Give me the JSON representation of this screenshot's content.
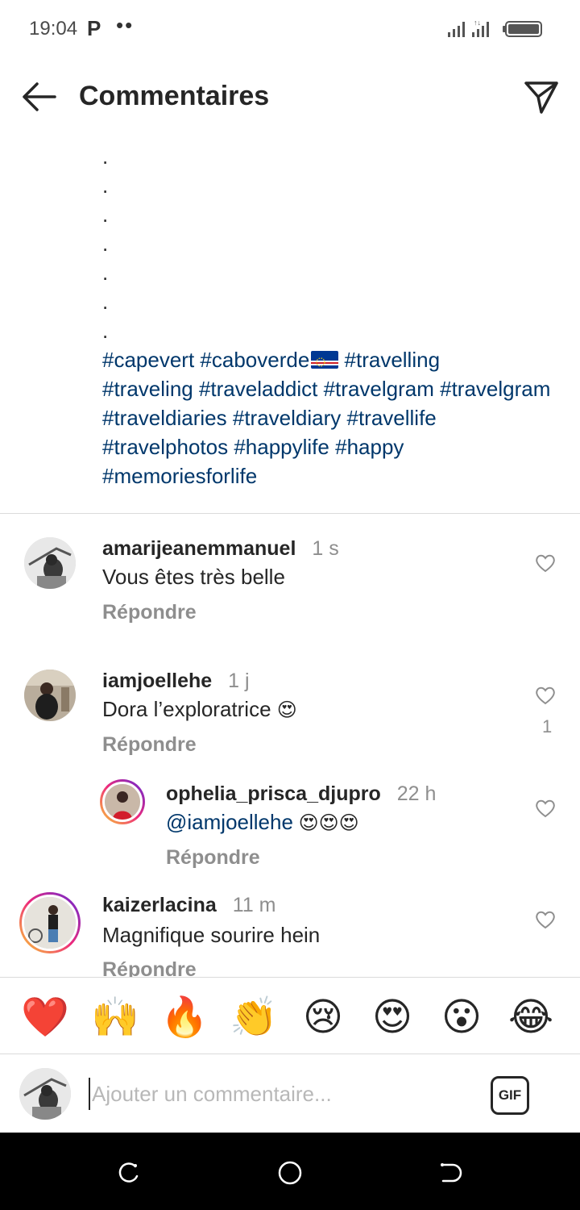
{
  "status_bar": {
    "time": "19:04",
    "app_indicator": "P",
    "dots": "••",
    "icons": [
      "signal-icon",
      "signal-icon",
      "battery-icon"
    ]
  },
  "header": {
    "title": "Commentaires",
    "back_icon": "arrow-left-icon",
    "send_icon": "paper-plane-icon"
  },
  "caption": {
    "dots": [
      ".",
      ".",
      ".",
      ".",
      ".",
      ".",
      "."
    ],
    "hashtags": {
      "line1_a": "#capevert #caboverde",
      "line1_b": " #travelling",
      "line2": "#traveling #traveladdict #travelgram",
      "line3": "#travelgram #traveldiaries #traveldiary",
      "line4": "#travellife #travelphotos #happylife",
      "line5": "#happy #memoriesforlife"
    }
  },
  "comments": [
    {
      "username": "amarijeanemmanuel",
      "time": "1 s",
      "text": "Vous êtes très belle",
      "reply": "Répondre",
      "likes": ""
    },
    {
      "username": "iamjoellehe",
      "time": "1 j",
      "text": "Dora l’exploratrice ",
      "emoji": "😍",
      "reply": "Répondre",
      "likes": "1"
    },
    {
      "username": "ophelia_prisca_djupro",
      "time": "22 h",
      "mention": "@iamjoellehe",
      "emoji": " 😍😍😍",
      "reply": "Répondre",
      "likes": ""
    },
    {
      "username": "kaizerlacina",
      "time": "11 m",
      "text": "Magnifique sourire hein",
      "reply": "Répondre",
      "likes": ""
    }
  ],
  "emoji_bar": [
    "❤️",
    "🙌",
    "🔥",
    "👏",
    "😢",
    "😍",
    "😮",
    "😂"
  ],
  "composer": {
    "placeholder": "Ajouter un commentaire...",
    "gif_label": "GIF"
  },
  "nav_bar": {
    "buttons": [
      "recent-apps-icon",
      "home-icon",
      "back-icon"
    ]
  },
  "colors": {
    "hashtag": "#00376b",
    "secondary_text": "#8e8e8e",
    "divider": "#dbdbdb"
  }
}
